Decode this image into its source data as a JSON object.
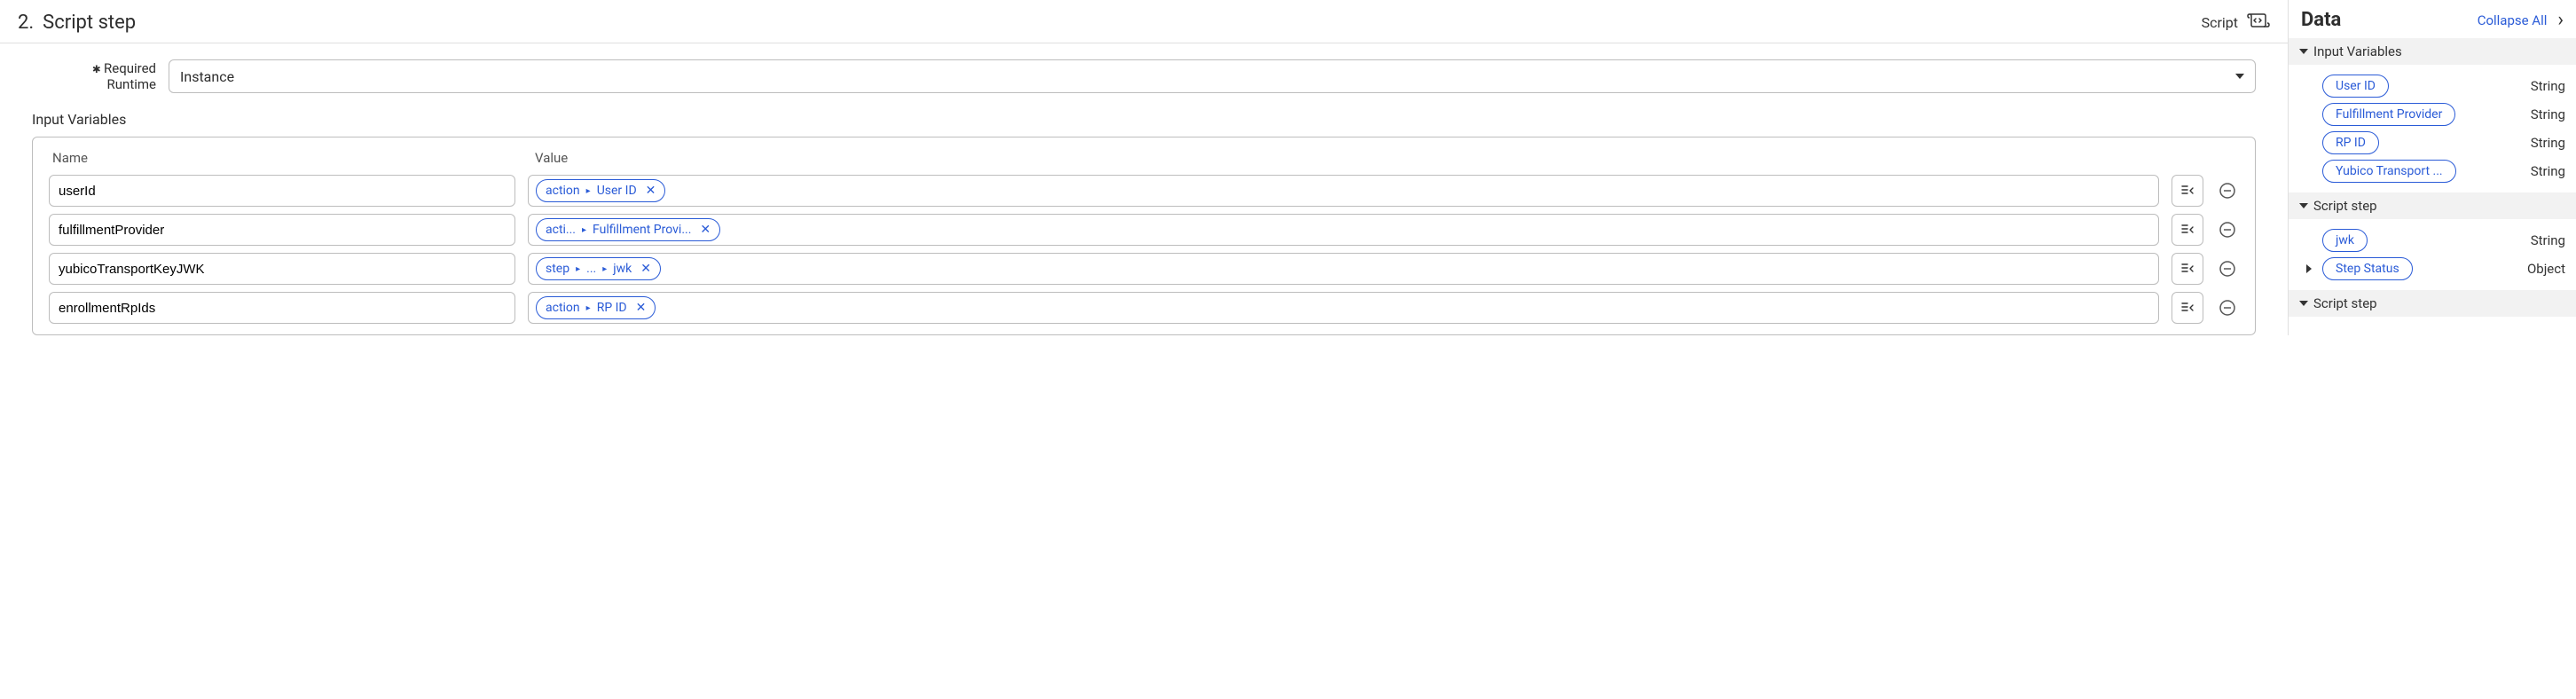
{
  "header": {
    "step_number": "2.",
    "step_name": "Script step",
    "right_label": "Script"
  },
  "form": {
    "runtime_label_prefix": "✱",
    "runtime_label_line1": "Required",
    "runtime_label_line2": "Runtime",
    "runtime_value": "Instance"
  },
  "input_variables": {
    "title": "Input Variables",
    "col_name": "Name",
    "col_value": "Value",
    "rows": [
      {
        "name": "userId",
        "pill_segments": [
          "action",
          "User ID"
        ]
      },
      {
        "name": "fulfillmentProvider",
        "pill_segments": [
          "acti...",
          "Fulfillment Provi..."
        ]
      },
      {
        "name": "yubicoTransportKeyJWK",
        "pill_segments": [
          "step",
          "...",
          "jwk"
        ]
      },
      {
        "name": "enrollmentRpIds",
        "pill_segments": [
          "action",
          "RP ID"
        ]
      }
    ]
  },
  "side": {
    "title": "Data",
    "collapse_all": "Collapse All",
    "groups": [
      {
        "label": "Input Variables",
        "expanded": true,
        "items": [
          {
            "label": "User ID",
            "type": "String",
            "expandable": false
          },
          {
            "label": "Fulfillment Provider",
            "type": "String",
            "expandable": false
          },
          {
            "label": "RP ID",
            "type": "String",
            "expandable": false
          },
          {
            "label": "Yubico Transport ...",
            "type": "String",
            "expandable": false
          }
        ]
      },
      {
        "label": "Script step",
        "expanded": true,
        "items": [
          {
            "label": "jwk",
            "type": "String",
            "expandable": false
          },
          {
            "label": "Step Status",
            "type": "Object",
            "expandable": true
          }
        ]
      },
      {
        "label": "Script step",
        "expanded": true,
        "items": []
      }
    ]
  }
}
